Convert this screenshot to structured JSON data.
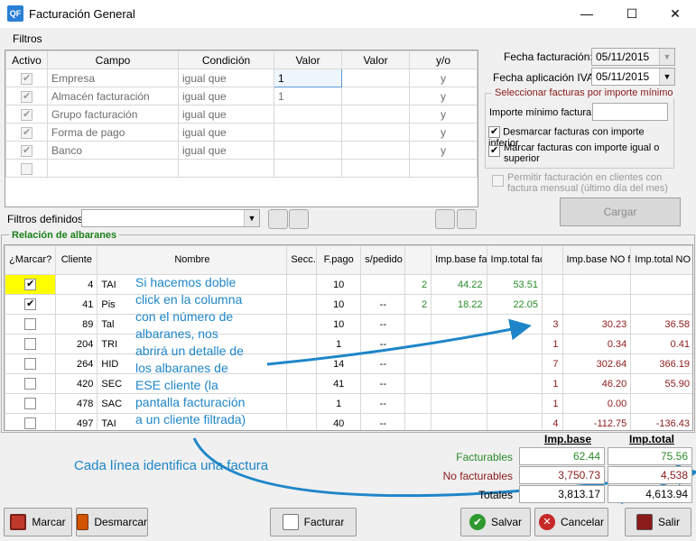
{
  "window": {
    "title": "Facturación General",
    "app_icon_text": "QF"
  },
  "filters": {
    "label": "Filtros",
    "columns": [
      "Activo",
      "Campo",
      "Condición",
      "Valor",
      "Valor",
      "y/o"
    ],
    "rows": [
      {
        "campo": "Empresa",
        "condicion": "igual que",
        "valor1": "1",
        "valor2": "",
        "yo": "y"
      },
      {
        "campo": "Almacén facturación",
        "condicion": "igual que",
        "valor1": "1",
        "valor2": "",
        "yo": "y"
      },
      {
        "campo": "Grupo facturación",
        "condicion": "igual que",
        "valor1": "",
        "valor2": "",
        "yo": "y"
      },
      {
        "campo": "Forma de pago",
        "condicion": "igual que",
        "valor1": "",
        "valor2": "",
        "yo": "y"
      },
      {
        "campo": "Banco",
        "condicion": "igual que",
        "valor1": "",
        "valor2": "",
        "yo": "y"
      },
      {
        "campo": "",
        "condicion": "",
        "valor1": "",
        "valor2": "",
        "yo": ""
      }
    ],
    "defined_label": "Filtros definidos:"
  },
  "dates": {
    "fecha_facturacion_label": "Fecha facturación:",
    "fecha_facturacion": "05/11/2015",
    "fecha_iva_label": "Fecha aplicación IVA:",
    "fecha_iva": "05/11/2015"
  },
  "min_import": {
    "title": "Seleccionar facturas por importe mínimo",
    "importe_label": "Importe mínimo factura",
    "desmarcar_label": "Desmarcar facturas con importe inferior",
    "marcar_label": "Marcar facturas con importe igual o superior"
  },
  "permitir_label": "Permitir facturación en clientes con factura mensual (último día del mes)",
  "cargar_label": "Cargar",
  "albaranes": {
    "title": "Relación de albaranes",
    "columns": [
      "¿Marcar?",
      "Cliente",
      "Nombre",
      "Secc.",
      "F.pago",
      "s/pedido",
      "",
      "Imp.base facturable",
      "Imp.total facturable",
      "",
      "Imp.base NO facturable",
      "Imp.total NO facturable"
    ],
    "rows": [
      {
        "checked": true,
        "cliente": "4",
        "nombre": "TAI",
        "secc": "",
        "fpago": "10",
        "spedido": "",
        "n1": "2",
        "base": "44.22",
        "total": "53.51",
        "n2": "",
        "base_no": "",
        "total_no": ""
      },
      {
        "checked": true,
        "cliente": "41",
        "nombre": "Pis",
        "secc": "",
        "fpago": "10",
        "spedido": "--",
        "n1": "2",
        "base": "18.22",
        "total": "22.05",
        "n2": "",
        "base_no": "",
        "total_no": ""
      },
      {
        "checked": false,
        "cliente": "89",
        "nombre": "Tal",
        "secc": "",
        "fpago": "10",
        "spedido": "--",
        "n1": "",
        "base": "",
        "total": "",
        "n2": "3",
        "base_no": "30.23",
        "total_no": "36.58"
      },
      {
        "checked": false,
        "cliente": "204",
        "nombre": "TRI",
        "secc": "",
        "fpago": "1",
        "spedido": "--",
        "n1": "",
        "base": "",
        "total": "",
        "n2": "1",
        "base_no": "0.34",
        "total_no": "0.41"
      },
      {
        "checked": false,
        "cliente": "264",
        "nombre": "HID",
        "secc": "",
        "fpago": "14",
        "spedido": "--",
        "n1": "",
        "base": "",
        "total": "",
        "n2": "7",
        "base_no": "302.64",
        "total_no": "366.19"
      },
      {
        "checked": false,
        "cliente": "420",
        "nombre": "SEC",
        "secc": "",
        "fpago": "41",
        "spedido": "--",
        "n1": "",
        "base": "",
        "total": "",
        "n2": "1",
        "base_no": "46.20",
        "total_no": "55.90"
      },
      {
        "checked": false,
        "cliente": "478",
        "nombre": "SAC",
        "secc": "",
        "fpago": "1",
        "spedido": "--",
        "n1": "",
        "base": "",
        "total": "",
        "n2": "1",
        "base_no": "0.00",
        "total_no": ""
      },
      {
        "checked": false,
        "cliente": "497",
        "nombre": "TAI",
        "secc": "",
        "fpago": "40",
        "spedido": "--",
        "n1": "",
        "base": "",
        "total": "",
        "n2": "4",
        "base_no": "-112.75",
        "total_no": "-136.43"
      }
    ]
  },
  "annotations": {
    "doble_click": "Si hacemos doble click en la columna con el número de albaranes, nos abrirá un detalle de los albaranes de ESE cliente (la pantalla facturación a un cliente filtrada)",
    "cada_linea": "Cada línea identifica una factura"
  },
  "summary": {
    "header_base": "Imp.base",
    "header_total": "Imp.total",
    "facturables_label": "Facturables",
    "facturables_base": "62.44",
    "facturables_total": "75.56",
    "no_facturables_label": "No facturables",
    "no_facturables_base": "3,750.73",
    "no_facturables_total": "4,538",
    "totales_label": "Totales",
    "totales_base": "3,813.17",
    "totales_total": "4,613.94"
  },
  "footer": {
    "marcar": "Marcar",
    "desmarcar": "Desmarcar",
    "facturar": "Facturar",
    "salvar": "Salvar",
    "cancelar": "Cancelar",
    "salir": "Salir"
  },
  "colors": {
    "annotation": "#1e86c8",
    "section_title": "#1a7f1a",
    "group_title": "#8b1a1a"
  }
}
